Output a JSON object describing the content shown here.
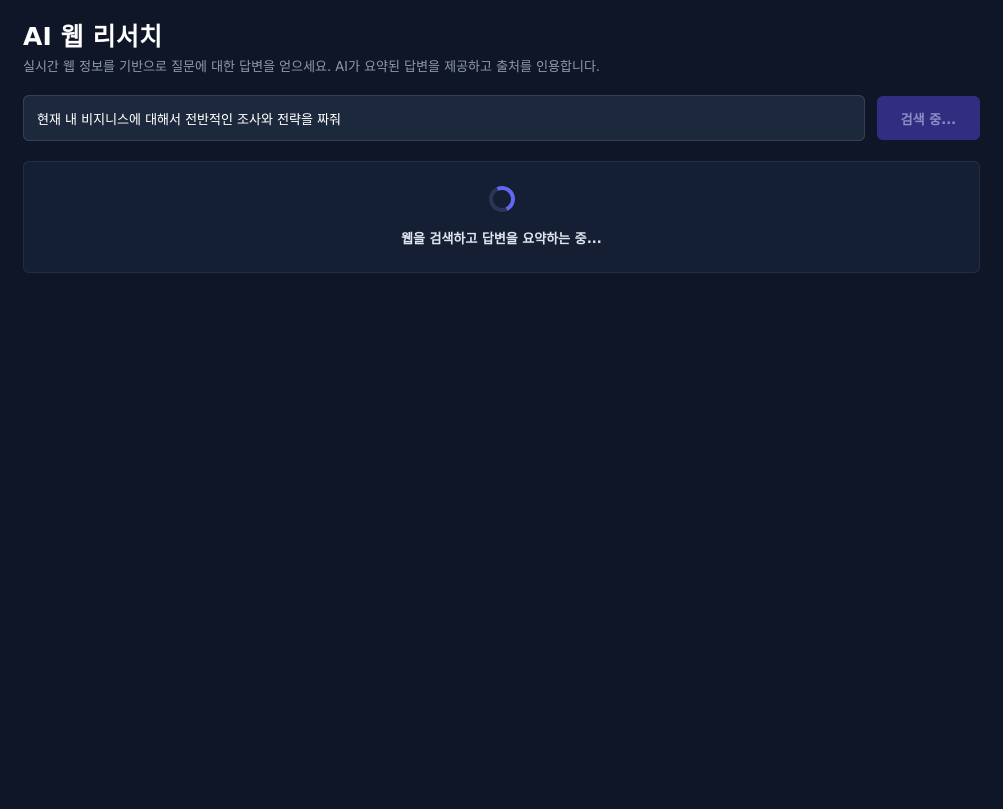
{
  "header": {
    "title": "AI 웹 리서치",
    "subtitle": "실시간 웹 정보를 기반으로 질문에 대한 답변을 얻으세요. AI가 요약된 답변을 제공하고 출처를 인용합니다."
  },
  "search": {
    "value": "현재 내 비지니스에 대해서 전반적인 조사와 전략을 짜줘",
    "placeholder": "",
    "button_label": "검색 중..."
  },
  "status": {
    "loading_text": "웹을 검색하고 답변을 요약하는 중..."
  },
  "colors": {
    "background": "#0e1628",
    "input_bg": "#1c283b",
    "button_bg": "#312e81",
    "spinner_accent": "#6366f1"
  },
  "icons": {
    "spinner": "loading-spinner-icon"
  }
}
